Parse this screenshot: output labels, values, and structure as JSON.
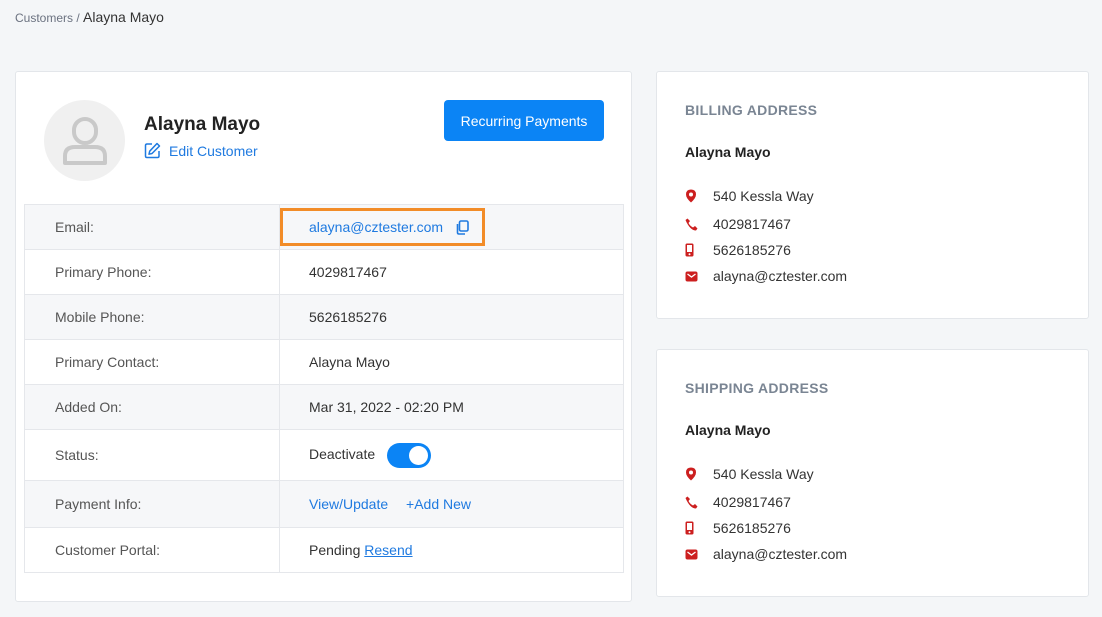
{
  "breadcrumb": {
    "parent": "Customers",
    "separator": " / ",
    "current": "Alayna Mayo"
  },
  "customer": {
    "name": "Alayna Mayo",
    "edit_label": "Edit Customer",
    "recurring_label": "Recurring Payments"
  },
  "details": {
    "email_label": "Email:",
    "email_value": "alayna@cztester.com",
    "primary_phone_label": "Primary Phone:",
    "primary_phone_value": "4029817467",
    "mobile_phone_label": "Mobile Phone:",
    "mobile_phone_value": "5626185276",
    "primary_contact_label": "Primary Contact:",
    "primary_contact_value": "Alayna Mayo",
    "added_on_label": "Added On:",
    "added_on_value": "Mar 31, 2022 - 02:20 PM",
    "status_label": "Status:",
    "status_value": "Deactivate",
    "status_on": true,
    "payment_info_label": "Payment Info:",
    "view_update": "View/Update",
    "add_new": "+Add New",
    "portal_label": "Customer Portal:",
    "portal_status": "Pending",
    "resend": "Resend"
  },
  "billing": {
    "title": "BILLING ADDRESS",
    "name": "Alayna Mayo",
    "street": "540 Kessla Way",
    "phone": "4029817467",
    "mobile": "5626185276",
    "email": "alayna@cztester.com"
  },
  "shipping": {
    "title": "SHIPPING ADDRESS",
    "name": "Alayna Mayo",
    "street": "540 Kessla Way",
    "phone": "4029817467",
    "mobile": "5626185276",
    "email": "alayna@cztester.com"
  },
  "colors": {
    "accent": "#0b84f5",
    "link": "#1f7ae0",
    "highlight": "#f28c28",
    "address_icon": "#cc1f1f"
  },
  "icons": [
    "user-avatar-icon",
    "edit-icon",
    "copy-icon",
    "map-pin-icon",
    "phone-icon",
    "mobile-icon",
    "mail-icon"
  ]
}
